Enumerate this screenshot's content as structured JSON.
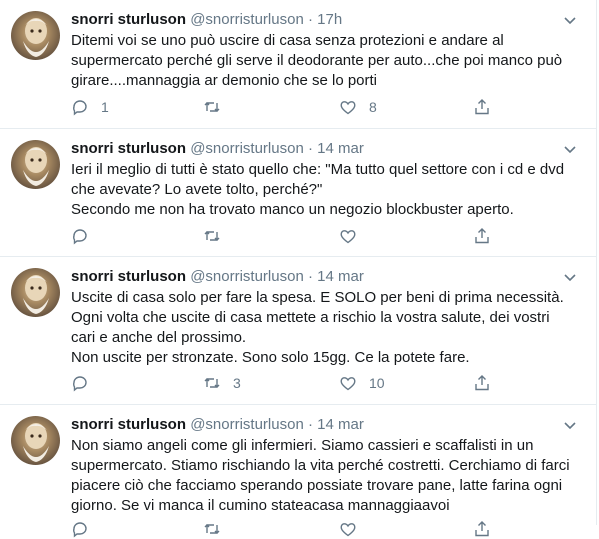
{
  "tweets": [
    {
      "name": "snorri sturluson",
      "handle": "@snorristurluson",
      "dot": "·",
      "time": "17h",
      "text": "Ditemi voi se uno può uscire di casa senza protezioni e andare al supermercato perché gli serve il deodorante per auto...che poi manco può girare....mannaggia ar demonio che se lo porti",
      "replies": "1",
      "retweets": "",
      "likes": "8"
    },
    {
      "name": "snorri sturluson",
      "handle": "@snorristurluson",
      "dot": "·",
      "time": "14 mar",
      "text": "Ieri il meglio di tutti è  stato quello che: \"Ma tutto quel settore con i cd e dvd che avevate? Lo avete tolto,  perché?\"\nSecondo me non ha trovato manco un negozio blockbuster aperto.",
      "replies": "",
      "retweets": "",
      "likes": ""
    },
    {
      "name": "snorri sturluson",
      "handle": "@snorristurluson",
      "dot": "·",
      "time": "14 mar",
      "text": "Uscite di casa solo per fare la spesa. E SOLO per beni di prima necessità.\nOgni volta che uscite di casa mettete a rischio la vostra salute, dei vostri cari e anche del prossimo.\nNon uscite per stronzate. Sono solo 15gg. Ce la potete fare.",
      "replies": "",
      "retweets": "3",
      "likes": "10"
    },
    {
      "name": "snorri sturluson",
      "handle": "@snorristurluson",
      "dot": "·",
      "time": "14 mar",
      "text": "Non siamo angeli come gli infermieri. Siamo cassieri e scaffalisti in un supermercato. Stiamo rischiando la vita perché costretti. Cerchiamo di farci piacere ciò che facciamo sperando possiate trovare pane, latte farina ogni giorno. Se vi manca il cumino stateacasa mannaggiaavoi",
      "replies": "",
      "retweets": "",
      "likes": ""
    }
  ],
  "icons": {
    "reply": "reply-icon",
    "retweet": "retweet-icon",
    "like": "heart-icon",
    "share": "share-icon",
    "more": "chevron-down-icon",
    "avatar": "avatar"
  },
  "colors": {
    "name": "#14171a",
    "secondary": "#657786",
    "divider": "#e6ecf0"
  }
}
